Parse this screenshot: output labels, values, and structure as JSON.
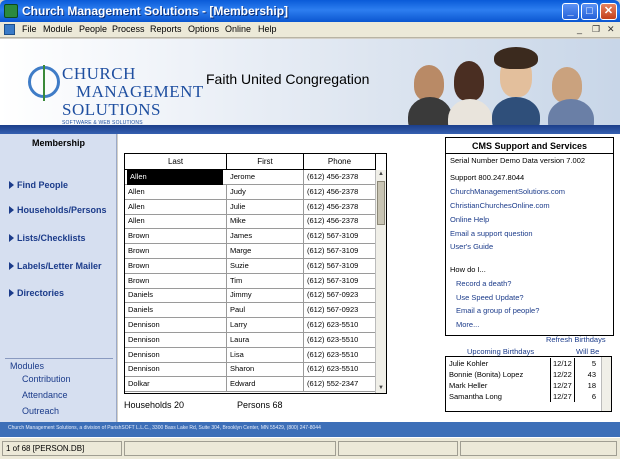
{
  "window": {
    "title": "Church Management Solutions - [Membership]",
    "min": "_",
    "max": "□",
    "close": "✕",
    "mdi_min": "_",
    "mdi_restore": "❐",
    "mdi_close": "✕"
  },
  "menu": [
    "File",
    "Module",
    "People",
    "Process",
    "Reports",
    "Options",
    "Online",
    "Help"
  ],
  "banner": {
    "logo_line1": "CHURCH",
    "logo_line2": "MANAGEMENT",
    "logo_line3": "SOLUTIONS",
    "logo_tagline": "SOFTWARE & WEB SOLUTIONS",
    "org_name": "Faith United Congregation"
  },
  "sidebar": {
    "title": "Membership",
    "items": [
      "Find People",
      "Households/Persons",
      "Lists/Checklists",
      "Labels/Letter Mailer",
      "Directories"
    ],
    "modules_title": "Modules",
    "modules": [
      "Contribution",
      "Attendance",
      "Outreach"
    ]
  },
  "grid": {
    "columns": [
      "Last",
      "First",
      "Phone"
    ],
    "rows": [
      [
        "Allen",
        "Jerome",
        "(612) 456-2378"
      ],
      [
        "Allen",
        "Judy",
        "(612) 456-2378"
      ],
      [
        "Allen",
        "Julie",
        "(612) 456-2378"
      ],
      [
        "Allen",
        "Mike",
        "(612) 456-2378"
      ],
      [
        "Brown",
        "James",
        "(612) 567-3109"
      ],
      [
        "Brown",
        "Marge",
        "(612) 567-3109"
      ],
      [
        "Brown",
        "Suzie",
        "(612) 567-3109"
      ],
      [
        "Brown",
        "Tim",
        "(612) 567-3109"
      ],
      [
        "Daniels",
        "Jimmy",
        "(612) 567-0923"
      ],
      [
        "Daniels",
        "Paul",
        "(612) 567-0923"
      ],
      [
        "Dennison",
        "Larry",
        "(612) 623-5510"
      ],
      [
        "Dennison",
        "Laura",
        "(612) 623-5510"
      ],
      [
        "Dennison",
        "Lisa",
        "(612) 623-5510"
      ],
      [
        "Dennison",
        "Sharon",
        "(612) 623-5510"
      ],
      [
        "Dolkar",
        "Edward",
        "(612) 552-2347"
      ]
    ],
    "selected_row": 0
  },
  "totals": {
    "households": "Households  20",
    "persons": "Persons  68"
  },
  "support": {
    "title": "CMS Support and Services",
    "serial": "Serial Number Demo   Data version  7.002",
    "phone": "Support 800.247.8044",
    "links": [
      "ChurchManagementSolutions.com",
      "ChristianChurchesOnline.com",
      "Online Help",
      "Email a support question",
      "User's Guide"
    ],
    "howdoi": "How do I...",
    "howdoi_links": [
      "Record a death?",
      "Use Speed Update?",
      "Email a group of people?",
      "More..."
    ]
  },
  "birthdays": {
    "refresh": "Refresh Birthdays",
    "heading": "Upcoming Birthdays",
    "will_be": "Will Be",
    "rows": [
      [
        "Julie Kohler",
        "12/12",
        "5"
      ],
      [
        "Bonnie (Bonita) Lopez",
        "12/22",
        "43"
      ],
      [
        "Mark Heller",
        "12/27",
        "18"
      ],
      [
        "Samantha Long",
        "12/27",
        "6"
      ]
    ]
  },
  "footer": {
    "text": "Church Management Solutions, a division of ParishSOFT L.L.C., 3300 Bass Lake Rd, Suite 304, Brooklyn Center, MN 55429, (800) 247-8044"
  },
  "status": {
    "record": "1 of 68 [PERSON.DB]"
  }
}
